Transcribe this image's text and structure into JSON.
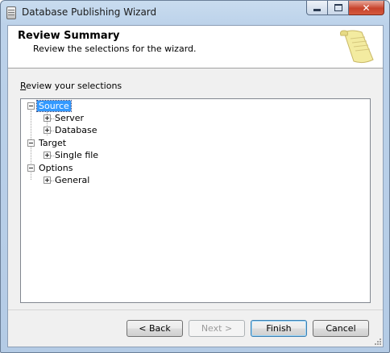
{
  "window": {
    "title": "Database Publishing Wizard"
  },
  "caption_buttons": {
    "minimize": "minimize-icon",
    "maximize": "maximize-icon",
    "close": "close-icon",
    "close_glyph": "✕"
  },
  "header": {
    "title": "Review Summary",
    "subtitle": "Review the selections for the wizard.",
    "icon": "scroll-icon"
  },
  "review": {
    "label_accesskey": "R",
    "label_rest": "eview your selections"
  },
  "tree": {
    "nodes": [
      {
        "label": "Source",
        "expanded": true,
        "selected": true
      },
      {
        "label": "Server",
        "expanded": false
      },
      {
        "label": "Database",
        "expanded": false
      },
      {
        "label": "Target",
        "expanded": true
      },
      {
        "label": "Single file",
        "expanded": false
      },
      {
        "label": "Options",
        "expanded": true
      },
      {
        "label": "General",
        "expanded": false
      }
    ]
  },
  "buttons": {
    "back": "< Back",
    "next": "Next >",
    "finish": "Finish",
    "cancel": "Cancel"
  },
  "colors": {
    "selection": "#3399ff",
    "titlebar": "#bcd2ea",
    "close": "#c7432c"
  }
}
